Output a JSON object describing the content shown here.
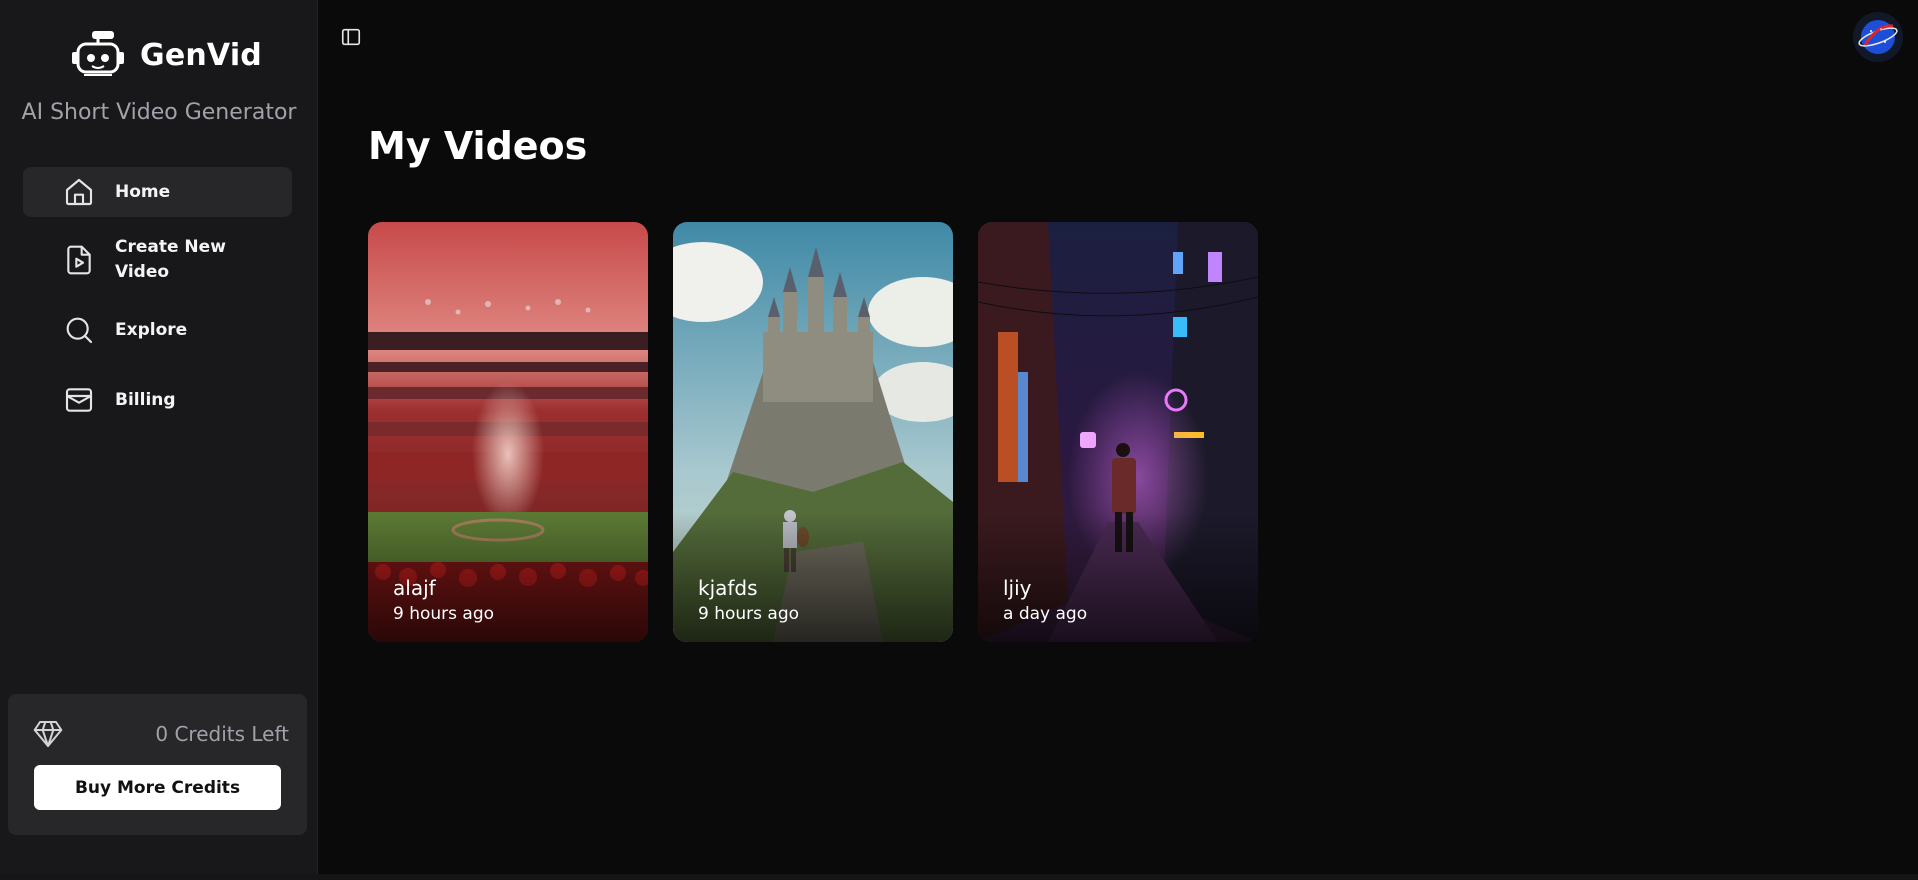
{
  "brand": {
    "name": "GenVid",
    "tagline": "AI Short Video Generator"
  },
  "sidebar": {
    "items": [
      {
        "label": "Home",
        "icon": "home-icon",
        "active": true
      },
      {
        "label": "Create New Video",
        "icon": "file-video-icon",
        "active": false
      },
      {
        "label": "Explore",
        "icon": "search-icon",
        "active": false
      },
      {
        "label": "Billing",
        "icon": "wallet-icon",
        "active": false
      }
    ],
    "credits": {
      "text": "0 Credits Left",
      "icon": "gem-icon",
      "button_label": "Buy More Credits"
    }
  },
  "topbar": {
    "toggle_icon": "panel-left-icon",
    "avatar": "user-avatar"
  },
  "main": {
    "title": "My Videos",
    "videos": [
      {
        "title": "alajf",
        "time": "9 hours ago",
        "thumbnail": "stadium-crowd"
      },
      {
        "title": "kjafds",
        "time": "9 hours ago",
        "thumbnail": "castle-knight"
      },
      {
        "title": "ljiy",
        "time": "a day ago",
        "thumbnail": "neon-alley"
      }
    ]
  },
  "colors": {
    "background": "#0a0a0b",
    "sidebar": "#18181b",
    "active_item": "#27272a",
    "card_bg": "#27272a",
    "text": "#f4f4f5",
    "muted_text": "#a1a1aa"
  }
}
